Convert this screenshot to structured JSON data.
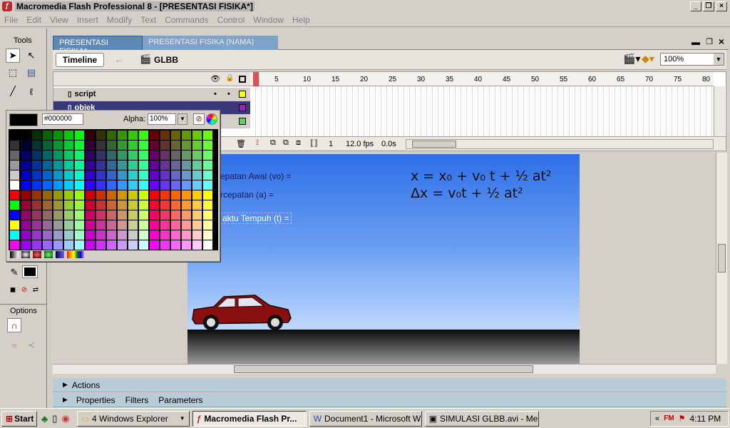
{
  "window": {
    "title": "Macromedia Flash Professional 8 - [PRESENTASI FISIKA*]"
  },
  "menu": [
    "File",
    "Edit",
    "View",
    "Insert",
    "Modify",
    "Text",
    "Commands",
    "Control",
    "Window",
    "Help"
  ],
  "tools": {
    "header": "Tools",
    "options_label": "Options"
  },
  "doc_tabs": [
    "PRESENTASI FISIKA*",
    "PRESENTASI FISIKA (NAMA)"
  ],
  "edit_bar": {
    "timeline_button": "Timeline",
    "scene": "GLBB",
    "zoom": "100%"
  },
  "timeline": {
    "frame_numbers": [
      "1",
      "5",
      "10",
      "15",
      "20",
      "25",
      "30",
      "35",
      "40",
      "45",
      "50",
      "55",
      "60",
      "65",
      "70",
      "75",
      "80"
    ],
    "layers": [
      {
        "name": "script"
      },
      {
        "name": "objek"
      }
    ],
    "current_frame": "1",
    "fps": "12.0 fps",
    "time": "0.0s"
  },
  "color_picker": {
    "hex": "#000000",
    "alpha_label": "Alpha:",
    "alpha": "100%"
  },
  "stage": {
    "label_velocity": "epatan Awal (vo) =",
    "label_accel": "rcepatan (a) =",
    "label_time": "aktu Tempuh (t) =",
    "formula1": "x =  x₀  +  v₀ t  +  ½ at²",
    "formula2": "Δx  =  v₀t  +  ½ at²"
  },
  "panels": {
    "actions": "Actions",
    "properties": "Properties",
    "filters": "Filters",
    "parameters": "Parameters"
  },
  "taskbar": {
    "start": "Start",
    "tasks": [
      "4 Windows Explorer",
      "Macromedia Flash Pr...",
      "Document1 - Microsoft W...",
      "SIMULASI GLBB.avi - Me..."
    ],
    "clock": "4:11 PM"
  }
}
